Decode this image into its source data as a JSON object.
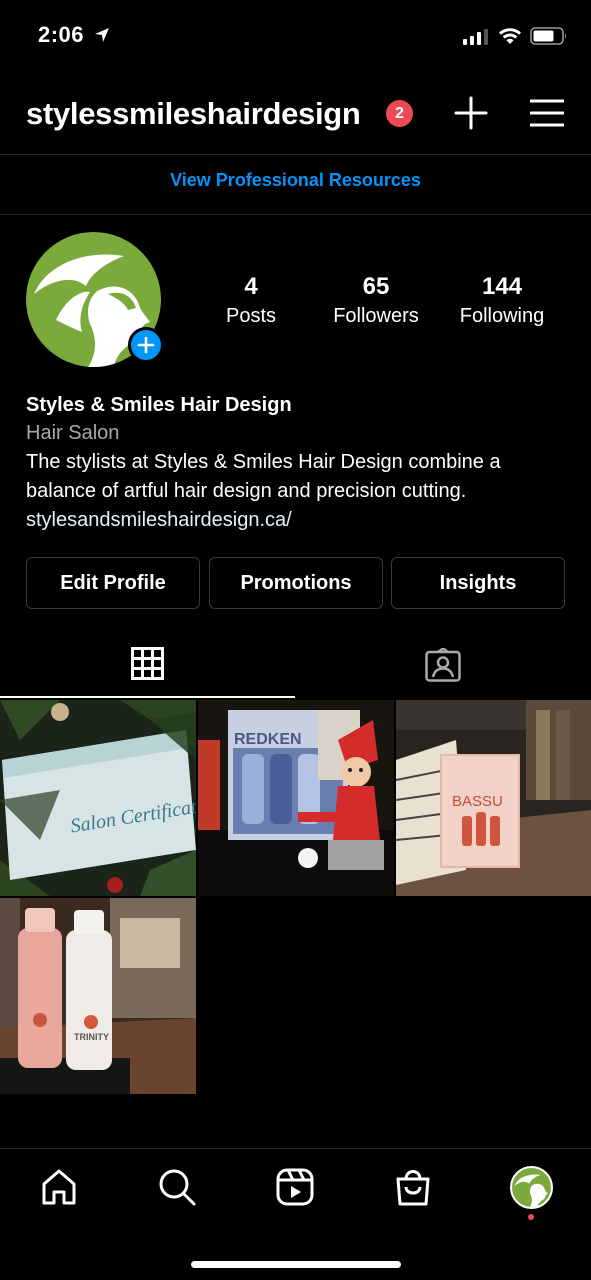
{
  "status_bar": {
    "time": "2:06",
    "icons": [
      "location-arrow-icon",
      "cellular-signal-icon",
      "wifi-icon",
      "battery-icon"
    ]
  },
  "header": {
    "username": "stylessmileshairdesign",
    "notification_count": "2",
    "icons": [
      "plus-icon",
      "hamburger-menu-icon"
    ]
  },
  "professional_link": "View Professional Resources",
  "profile": {
    "stats": {
      "posts": {
        "value": "4",
        "label": "Posts"
      },
      "followers": {
        "value": "65",
        "label": "Followers"
      },
      "following": {
        "value": "144",
        "label": "Following"
      }
    },
    "name": "Styles & Smiles Hair Design",
    "category": "Hair Salon",
    "bio_line1": "The stylists at Styles & Smiles Hair Design combine a",
    "bio_line2": "balance of artful hair design and precision cutting.",
    "website": "stylesandsmileshairdesign.ca/"
  },
  "buttons": {
    "edit_profile": "Edit Profile",
    "promotions": "Promotions",
    "insights": "Insights"
  },
  "tabs": [
    "grid-icon",
    "tagged-icon"
  ],
  "posts": [
    {
      "caption_text": "Salon Certificate",
      "scene": "gift certificate in christmas tree"
    },
    {
      "caption_text": "REDKEN",
      "scene": "elf on shelf beside redken box"
    },
    {
      "caption_text": "BASSU",
      "scene": "bassu product box"
    },
    {
      "caption_text": "TRINITY",
      "scene": "two shampoo bottles"
    }
  ],
  "bottom_nav": [
    "home-icon",
    "search-icon",
    "reels-icon",
    "shop-icon",
    "profile-avatar"
  ],
  "colors": {
    "accent_blue": "#0095f6",
    "badge_red": "#ed4956",
    "brand_green": "#7aaa3b",
    "background": "#000000"
  }
}
